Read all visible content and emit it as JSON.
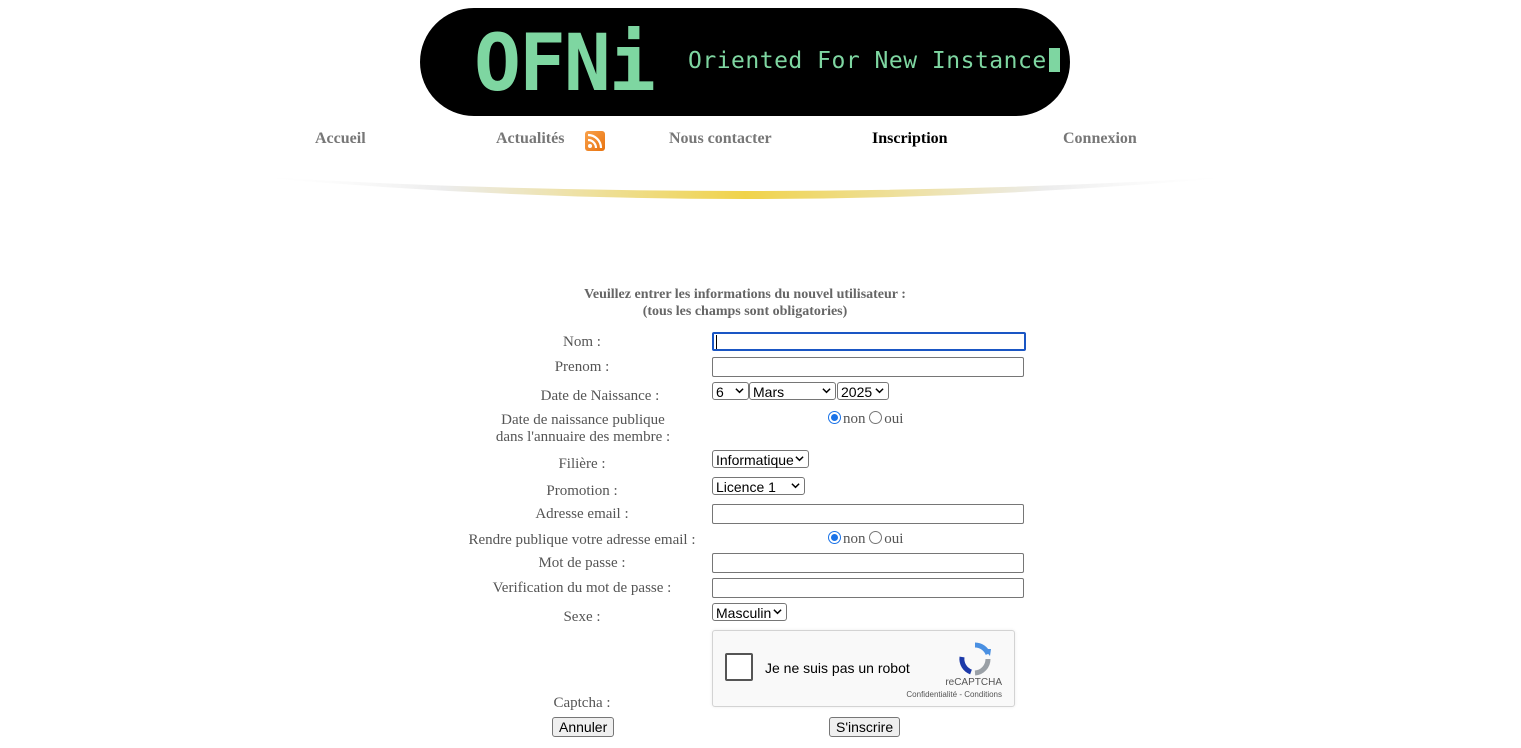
{
  "header": {
    "logo_text": "OFNi",
    "tagline": "Oriented For New Instance",
    "colors": {
      "banner_bg": "#000000",
      "logo": "#7ed6a1",
      "swoosh": "#f0d34a"
    }
  },
  "nav": {
    "items": [
      {
        "label": "Accueil"
      },
      {
        "label": "Actualités"
      },
      {
        "label": "Nous contacter"
      },
      {
        "label": "Inscription"
      },
      {
        "label": "Connexion"
      }
    ],
    "active": "Inscription",
    "rss_icon": "rss-icon"
  },
  "form": {
    "intro_line1": "Veuillez entrer les informations du nouvel utilisateur :",
    "intro_line2": "(tous les champs sont obligatories)",
    "labels": {
      "nom": "Nom :",
      "prenom": "Prenom :",
      "date_naissance": "Date de Naissance :",
      "date_publique_1": "Date de naissance publique",
      "date_publique_2": "dans l'annuaire des membre :",
      "filiere": "Filière :",
      "promotion": "Promotion :",
      "email": "Adresse email :",
      "email_publique": "Rendre publique votre adresse email :",
      "mdp": "Mot de passe :",
      "mdp_verif": "Verification du mot de passe :",
      "sexe": "Sexe :",
      "captcha": "Captcha :"
    },
    "values": {
      "nom": "",
      "prenom": "",
      "jour": "6",
      "mois": "Mars",
      "annee": "2025",
      "filiere": "Informatique",
      "promotion": "Licence 1",
      "email": "",
      "mdp": "",
      "mdp_verif": "",
      "sexe": "Masculin"
    },
    "radio": {
      "non": "non",
      "oui": "oui",
      "date_publique": "non",
      "email_publique": "non"
    },
    "captcha": {
      "checkbox_label": "Je ne suis pas un robot",
      "brand": "reCAPTCHA",
      "links": "Confidentialité - Conditions"
    },
    "buttons": {
      "cancel": "Annuler",
      "submit": "S'inscrire"
    }
  }
}
